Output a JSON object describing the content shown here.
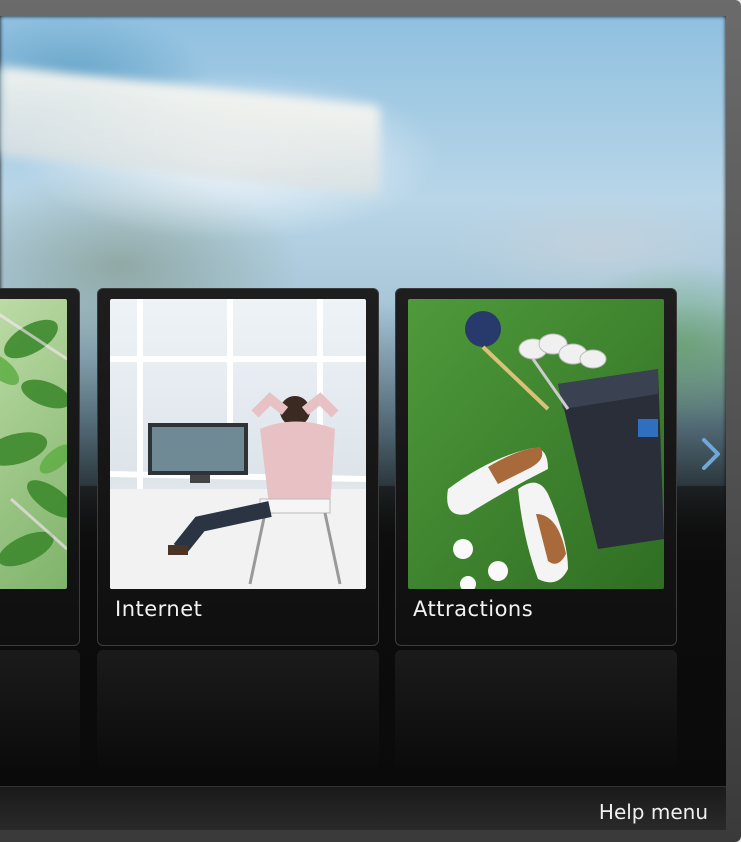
{
  "menu": {
    "tiles": [
      {
        "label": "",
        "icon": "nature-leaves-image"
      },
      {
        "label": "Internet",
        "icon": "internet-tv-image"
      },
      {
        "label": "Attractions",
        "icon": "golf-attractions-image"
      }
    ],
    "next_arrow_icon": "chevron-right-icon"
  },
  "footer": {
    "help_label": "Help menu"
  },
  "colors": {
    "accent": "#6fa8d8",
    "label_text": "#f2f2f2"
  }
}
